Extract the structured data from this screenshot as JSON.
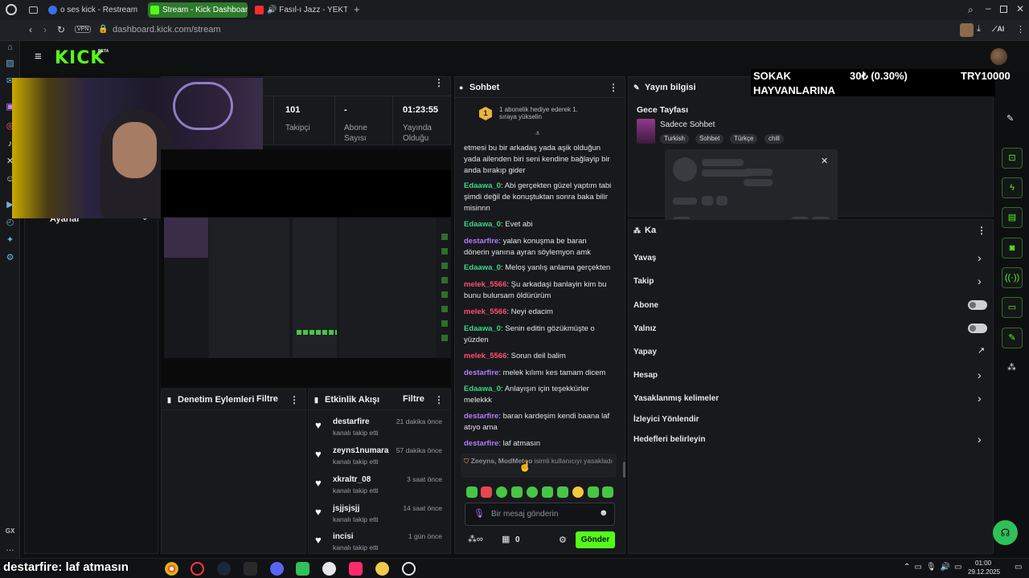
{
  "browser": {
    "tabs": [
      {
        "label": "o ses kick - Restream",
        "color": "#3b6ee8"
      },
      {
        "label": "Stream - Kick Dashboard",
        "color": "#53fc18"
      },
      {
        "label": "🔊 Fasıl-ı Jazz - YEKTE -",
        "color": "#ff2b2b"
      }
    ],
    "url": "dashboard.kick.com/stream",
    "ai_label": "AI"
  },
  "brand": {
    "logo": "KICK",
    "beta": "BETA"
  },
  "stats": [
    {
      "value": "101",
      "label": "Takipçi"
    },
    {
      "value": "-",
      "label": "Abone Sayısı"
    },
    {
      "value": "01:23:55",
      "label": "Yayında Olduğu"
    }
  ],
  "left_panel": {
    "settings_label": "Ayarlar"
  },
  "overlay": {
    "sokak_line1": "SOKAK",
    "sokak_line2": "HAYVANLARINA",
    "amount": "30₺ (0.30%)",
    "goal": "TRY10000"
  },
  "chat": {
    "title": "Sohbet",
    "pinned": {
      "count": "1",
      "text": "1 abonelik hediye ederek 1. sıraya yükselin"
    },
    "intro": "etmesi bu bir arkadaş yada aşik olduğun yada ailenden biri seni kendine bağlayip bir anda bırakıp gider",
    "messages": [
      {
        "user": "Edaawa_0",
        "color": "green",
        "text": "Abi gerçekten güzel yaptım tabi şimdi değil de konuştuktan sonra baka bilir misinnn"
      },
      {
        "user": "Edaawa_0",
        "color": "green",
        "text": "Evet abi"
      },
      {
        "user": "destarfire",
        "color": "purple",
        "text": "yalan konuşma be baran dönerin yanına ayran söylemyon amk"
      },
      {
        "user": "Edaawa_0",
        "color": "green",
        "text": "Meloş yanlış anlama gerçekten"
      },
      {
        "user": "melek_5566",
        "color": "red",
        "text": "Şu arkadaşi banlayin kim bu bunu bulursam öldürürüm"
      },
      {
        "user": "melek_5566",
        "color": "red",
        "text": "Neyi edacim"
      },
      {
        "user": "Edaawa_0",
        "color": "green",
        "text": "Senin editin gözükmüşte o yüzden"
      },
      {
        "user": "melek_5566",
        "color": "red",
        "text": "Sorun deil balim"
      },
      {
        "user": "destarfire",
        "color": "purple",
        "text": "melek kılımı kes tamam dicem"
      },
      {
        "user": "Edaawa_0",
        "color": "green",
        "text": "Anlayışın için teşekkürler melekkk"
      },
      {
        "user": "destarfire",
        "color": "purple",
        "text": "baran kardeşim kendi baana laf atıyo ama"
      },
      {
        "user": "destarfire",
        "color": "purple",
        "text": "laf atmasın"
      }
    ],
    "ban_notice": {
      "users": "Zeeyns, ModMetoo",
      "text": "isimli kullanıcıyı yasakladı"
    },
    "input_placeholder": "Bir mesaj gönderin",
    "points": "∞",
    "gift_count": "0",
    "send_label": "Gönder"
  },
  "stream_info": {
    "title": "Yayın bilgisi",
    "stream_title": "Gece Tayfası",
    "category": "Sadece Sohbet",
    "tags": [
      "Turkish",
      "Sohbet",
      "Türkçe",
      "chill"
    ]
  },
  "mod_panel": {
    "title": "Denetim Eylemleri",
    "filter": "Filtre"
  },
  "activity": {
    "title": "Etkinlik Akışı",
    "filter": "Filtre",
    "items": [
      {
        "name": "destarfire",
        "sub": "kanalı takip etti",
        "time": "21 dakika önce"
      },
      {
        "name": "zeyns1numara",
        "sub": "kanalı takip etti",
        "time": "57 dakika önce"
      },
      {
        "name": "xkraltr_08",
        "sub": "kanalı takip etti",
        "time": "3 saat önce"
      },
      {
        "name": "jsjjsjsjj",
        "sub": "kanalı takip etti",
        "time": "14 saat önce"
      },
      {
        "name": "incisi",
        "sub": "kanalı takip etti",
        "time": "1 gün önce"
      }
    ]
  },
  "channel_panel": {
    "title": "Ka",
    "rows": [
      "Yavaş",
      "Takip",
      "Abone",
      "Yalnız",
      "Yapay",
      "Hesap",
      "Yasaklanmış kelimeler",
      "İzleyici Yönlendir",
      "Hedefleri belirleyin"
    ]
  },
  "taskbar": {
    "overlay_text": "destarfire: laf atmasın",
    "time": "01:00",
    "date": "29.12.2025"
  },
  "sidebar_label": "GX"
}
